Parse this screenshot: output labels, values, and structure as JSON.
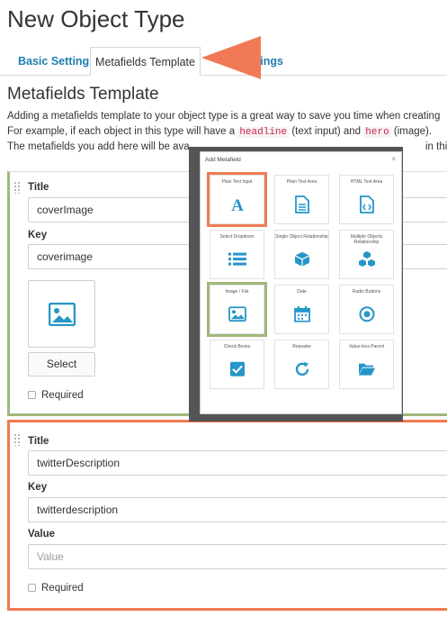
{
  "page_title": "New Object Type",
  "tabs": {
    "basic": "Basic Settings",
    "metafields": "Metafields Template",
    "other_partial": "ettings"
  },
  "section_title": "Metafields Template",
  "intro": {
    "line1": "Adding a metafields template to your object type is a great way to save you time when creating",
    "line2_before": "For example, if each object in this type will have a",
    "code1": "headline",
    "line2_mid": "(text input) and",
    "code2": "hero",
    "line2_after": "(image).",
    "line3": "The metafields you add here will be ava",
    "line3_tail": "in this"
  },
  "field1": {
    "title_label": "Title",
    "title_value": "coverImage",
    "key_label": "Key",
    "key_value": "coverimage",
    "select_label": "Select",
    "required_label": "Required"
  },
  "field2": {
    "title_label": "Title",
    "title_value": "twitterDescription",
    "key_label": "Key",
    "key_value": "twitterdescription",
    "value_label": "Value",
    "value_placeholder": "Value",
    "required_label": "Required"
  },
  "modal": {
    "title": "Add Metafield",
    "close": "×",
    "tiles": [
      {
        "label": "Plain Text Input",
        "icon": "text-a-icon"
      },
      {
        "label": "Plain Text Area",
        "icon": "document-icon"
      },
      {
        "label": "HTML Text Area",
        "icon": "code-file-icon"
      },
      {
        "label": "Select Dropdown",
        "icon": "list-icon"
      },
      {
        "label": "Single Object Relationship",
        "icon": "cube-icon"
      },
      {
        "label": "Multiple Objects Relationship",
        "icon": "cubes-icon"
      },
      {
        "label": "Image / File",
        "icon": "image-icon"
      },
      {
        "label": "Date",
        "icon": "calendar-icon"
      },
      {
        "label": "Radio Buttons",
        "icon": "radio-icon"
      },
      {
        "label": "Check Boxes",
        "icon": "checkbox-icon"
      },
      {
        "label": "Repeater",
        "icon": "repeat-icon"
      },
      {
        "label": "Value-less Parent",
        "icon": "folder-icon"
      }
    ]
  },
  "colors": {
    "accent_blue": "#1f7fae",
    "highlight_orange": "#f07a55",
    "highlight_green": "#9eb87b"
  }
}
